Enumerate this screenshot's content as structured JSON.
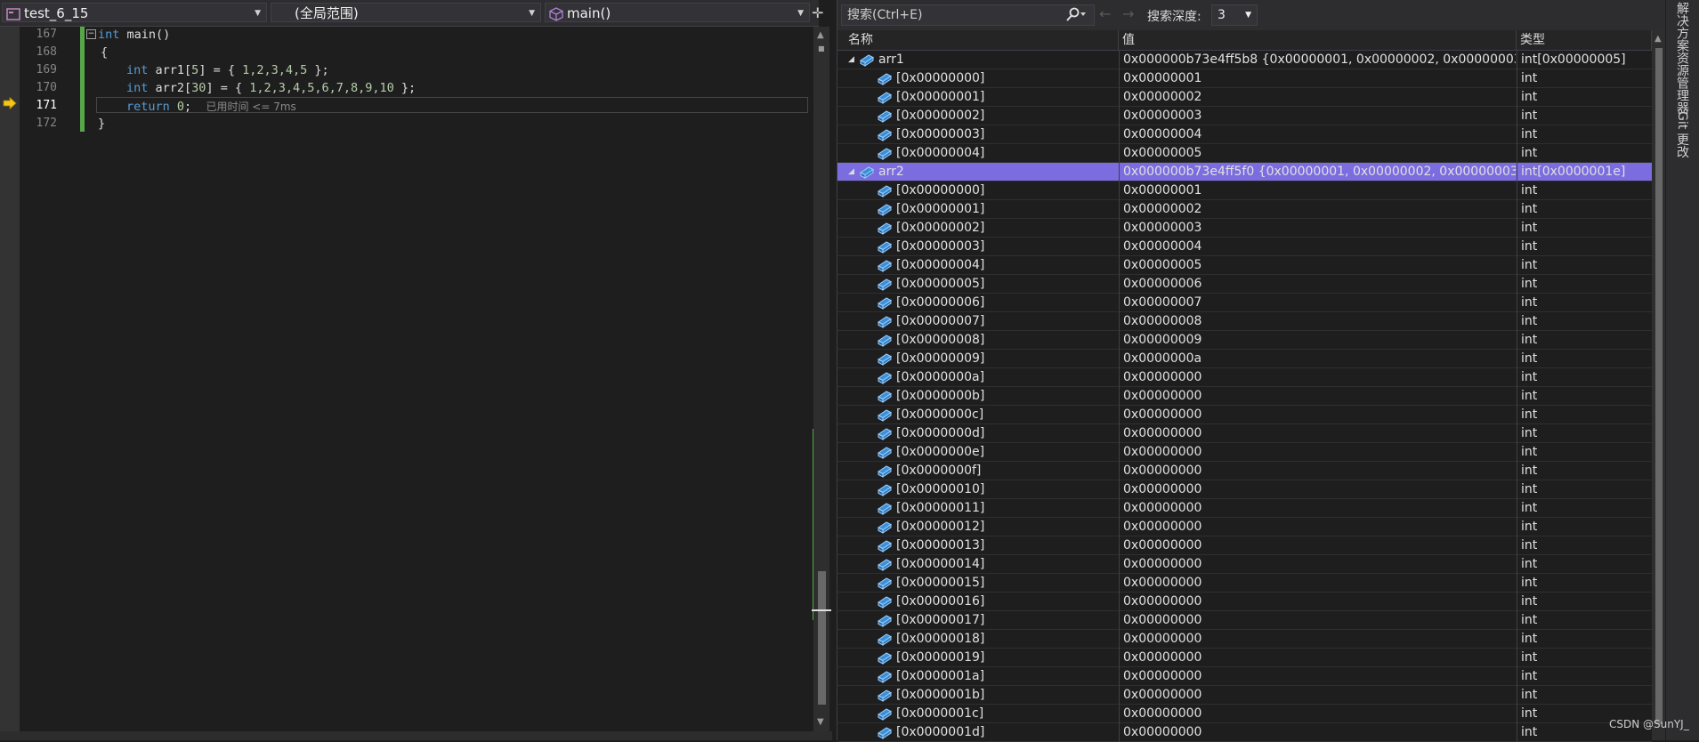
{
  "editor_nav": {
    "project": "test_6_15",
    "scope": "(全局范围)",
    "function": "main()"
  },
  "editor": {
    "line_numbers": [
      "167",
      "168",
      "169",
      "170",
      "171",
      "172"
    ],
    "code": {
      "line167_kw": "int",
      "line167_rest": " main()",
      "line168": "{",
      "line169_kw": "int",
      "line169_a": " arr1[",
      "line169_n": "5",
      "line169_b": "] = { ",
      "line169_vals": "1,2,3,4,5",
      "line169_c": " };",
      "line170_kw": "int",
      "line170_a": " arr2[",
      "line170_n": "30",
      "line170_b": "] = { ",
      "line170_vals": "1,2,3,4,5,6,7,8,9,10",
      "line170_c": " };",
      "line171_kw": "return",
      "line171_n": " 0",
      "line171_semi": ";",
      "line171_tip": "已用时间 <= 7ms",
      "line172": "}"
    }
  },
  "watch": {
    "search_placeholder": "搜索(Ctrl+E)",
    "depth_label": "搜索深度:",
    "depth_value": "3",
    "headers": {
      "name": "名称",
      "value": "值",
      "type": "类型"
    },
    "rows": [
      {
        "name": "arr1",
        "value": "0x000000b73e4ff5b8 {0x00000001, 0x00000002, 0x00000003, 0x0...",
        "type": "int[0x00000005]",
        "level": 0
      },
      {
        "name": "[0x00000000]",
        "value": "0x00000001",
        "type": "int",
        "level": 1
      },
      {
        "name": "[0x00000001]",
        "value": "0x00000002",
        "type": "int",
        "level": 1
      },
      {
        "name": "[0x00000002]",
        "value": "0x00000003",
        "type": "int",
        "level": 1
      },
      {
        "name": "[0x00000003]",
        "value": "0x00000004",
        "type": "int",
        "level": 1
      },
      {
        "name": "[0x00000004]",
        "value": "0x00000005",
        "type": "int",
        "level": 1
      },
      {
        "name": "arr2",
        "value": "0x000000b73e4ff5f0 {0x00000001, 0x00000002, 0x00000003, 0x00...",
        "type": "int[0x0000001e]",
        "level": 0,
        "selected": true
      },
      {
        "name": "[0x00000000]",
        "value": "0x00000001",
        "type": "int",
        "level": 1
      },
      {
        "name": "[0x00000001]",
        "value": "0x00000002",
        "type": "int",
        "level": 1
      },
      {
        "name": "[0x00000002]",
        "value": "0x00000003",
        "type": "int",
        "level": 1
      },
      {
        "name": "[0x00000003]",
        "value": "0x00000004",
        "type": "int",
        "level": 1
      },
      {
        "name": "[0x00000004]",
        "value": "0x00000005",
        "type": "int",
        "level": 1
      },
      {
        "name": "[0x00000005]",
        "value": "0x00000006",
        "type": "int",
        "level": 1
      },
      {
        "name": "[0x00000006]",
        "value": "0x00000007",
        "type": "int",
        "level": 1
      },
      {
        "name": "[0x00000007]",
        "value": "0x00000008",
        "type": "int",
        "level": 1
      },
      {
        "name": "[0x00000008]",
        "value": "0x00000009",
        "type": "int",
        "level": 1
      },
      {
        "name": "[0x00000009]",
        "value": "0x0000000a",
        "type": "int",
        "level": 1
      },
      {
        "name": "[0x0000000a]",
        "value": "0x00000000",
        "type": "int",
        "level": 1
      },
      {
        "name": "[0x0000000b]",
        "value": "0x00000000",
        "type": "int",
        "level": 1
      },
      {
        "name": "[0x0000000c]",
        "value": "0x00000000",
        "type": "int",
        "level": 1
      },
      {
        "name": "[0x0000000d]",
        "value": "0x00000000",
        "type": "int",
        "level": 1
      },
      {
        "name": "[0x0000000e]",
        "value": "0x00000000",
        "type": "int",
        "level": 1
      },
      {
        "name": "[0x0000000f]",
        "value": "0x00000000",
        "type": "int",
        "level": 1
      },
      {
        "name": "[0x00000010]",
        "value": "0x00000000",
        "type": "int",
        "level": 1
      },
      {
        "name": "[0x00000011]",
        "value": "0x00000000",
        "type": "int",
        "level": 1
      },
      {
        "name": "[0x00000012]",
        "value": "0x00000000",
        "type": "int",
        "level": 1
      },
      {
        "name": "[0x00000013]",
        "value": "0x00000000",
        "type": "int",
        "level": 1
      },
      {
        "name": "[0x00000014]",
        "value": "0x00000000",
        "type": "int",
        "level": 1
      },
      {
        "name": "[0x00000015]",
        "value": "0x00000000",
        "type": "int",
        "level": 1
      },
      {
        "name": "[0x00000016]",
        "value": "0x00000000",
        "type": "int",
        "level": 1
      },
      {
        "name": "[0x00000017]",
        "value": "0x00000000",
        "type": "int",
        "level": 1
      },
      {
        "name": "[0x00000018]",
        "value": "0x00000000",
        "type": "int",
        "level": 1
      },
      {
        "name": "[0x00000019]",
        "value": "0x00000000",
        "type": "int",
        "level": 1
      },
      {
        "name": "[0x0000001a]",
        "value": "0x00000000",
        "type": "int",
        "level": 1
      },
      {
        "name": "[0x0000001b]",
        "value": "0x00000000",
        "type": "int",
        "level": 1
      },
      {
        "name": "[0x0000001c]",
        "value": "0x00000000",
        "type": "int",
        "level": 1
      },
      {
        "name": "[0x0000001d]",
        "value": "0x00000000",
        "type": "int",
        "level": 1
      }
    ]
  },
  "side_tabs": [
    "解决方案资源管理器",
    "Git 更改"
  ],
  "watermark": "CSDN @SunYJ_",
  "colors": {
    "selection": "#7b6ce0",
    "keyword": "#569cd6",
    "change_bar": "#57a64a",
    "exec_arrow": "#f5c518"
  }
}
